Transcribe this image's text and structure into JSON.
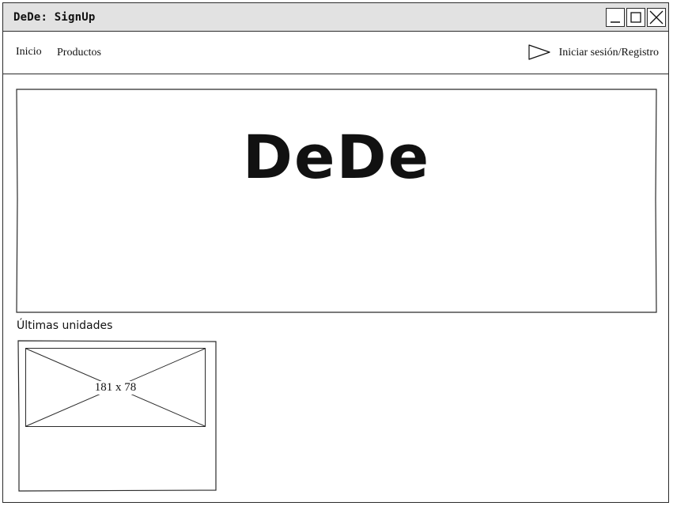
{
  "window": {
    "title": "DeDe: SignUp",
    "controls": {
      "minimize_icon": "minimize-icon",
      "maximize_icon": "maximize-icon",
      "close_icon": "close-icon"
    }
  },
  "navbar": {
    "links": [
      {
        "label": "Inicio"
      },
      {
        "label": "Productos"
      }
    ],
    "login": {
      "icon": "play-triangle-icon",
      "label": "Iniciar sesión/Registro"
    }
  },
  "hero": {
    "title": "DeDe"
  },
  "products": {
    "section_title": "Últimas unidades",
    "items": [
      {
        "image_placeholder": "181 x 78"
      }
    ]
  },
  "colors": {
    "titlebar_bg": "#e2e2e2",
    "border": "#2b2b2b",
    "text": "#111111",
    "background": "#ffffff"
  }
}
